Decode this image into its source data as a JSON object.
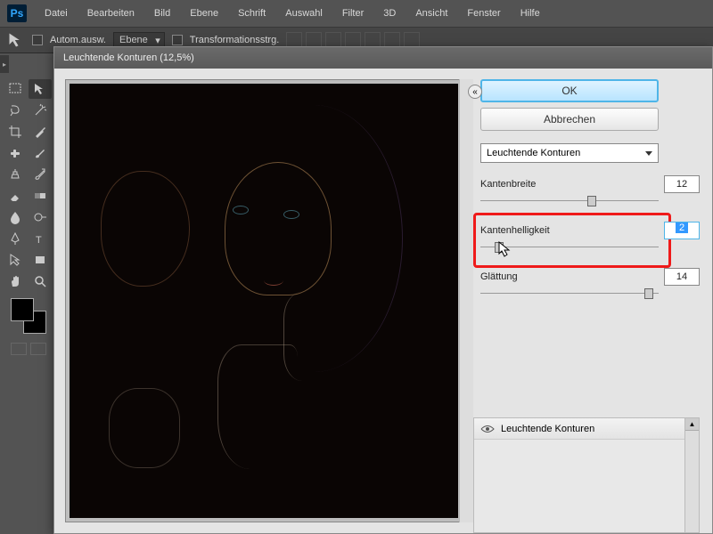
{
  "menu": [
    "Datei",
    "Bearbeiten",
    "Bild",
    "Ebene",
    "Schrift",
    "Auswahl",
    "Filter",
    "3D",
    "Ansicht",
    "Fenster",
    "Hilfe"
  ],
  "options": {
    "auto_select": "Autom.ausw.",
    "layer_dropdown": "Ebene",
    "transform": "Transformationsstrg."
  },
  "dialog": {
    "title": "Leuchtende Konturen (12,5%)",
    "ok": "OK",
    "cancel": "Abbrechen",
    "filter_name": "Leuchtende Konturen",
    "params": {
      "edge_width": {
        "label": "Kantenbreite",
        "value": "12",
        "thumb_pos": "60%"
      },
      "edge_brightness": {
        "label": "Kantenhelligkeit",
        "value": "2",
        "thumb_pos": "8%"
      },
      "smoothness": {
        "label": "Glättung",
        "value": "14",
        "thumb_pos": "92%"
      }
    },
    "stack_item": "Leuchtende Konturen"
  }
}
